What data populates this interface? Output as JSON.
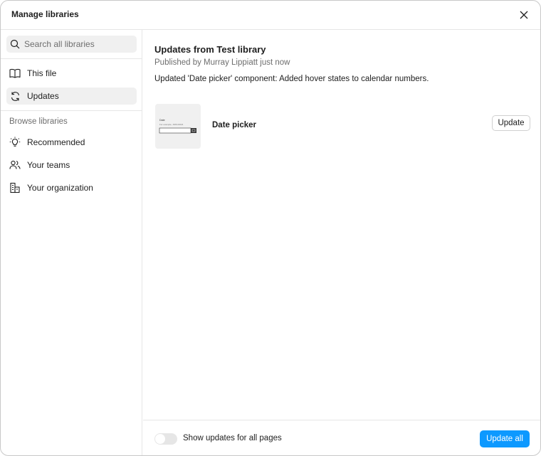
{
  "dialog": {
    "title": "Manage libraries"
  },
  "sidebar": {
    "search_placeholder": "Search all libraries",
    "items": [
      {
        "label": "This file",
        "icon": "book-icon",
        "active": false
      },
      {
        "label": "Updates",
        "icon": "refresh-icon",
        "active": true
      }
    ],
    "browse_label": "Browse libraries",
    "browse_items": [
      {
        "label": "Recommended",
        "icon": "lightbulb-icon"
      },
      {
        "label": "Your teams",
        "icon": "people-icon"
      },
      {
        "label": "Your organization",
        "icon": "building-icon"
      }
    ]
  },
  "main": {
    "title": "Updates from Test library",
    "subtitle": "Published by Murray Lippiatt just now",
    "description": "Updated 'Date picker' component: Added hover states to calendar numbers.",
    "component": {
      "name": "Date picker",
      "thumb_label": "Date",
      "thumb_hint": "For example, 15/01/2024",
      "update_label": "Update"
    }
  },
  "footer": {
    "toggle_label": "Show updates for all pages",
    "toggle_on": false,
    "update_all_label": "Update all"
  },
  "colors": {
    "accent": "#0d99ff",
    "muted": "#6e6e6e",
    "surface": "#f0f0f0"
  }
}
